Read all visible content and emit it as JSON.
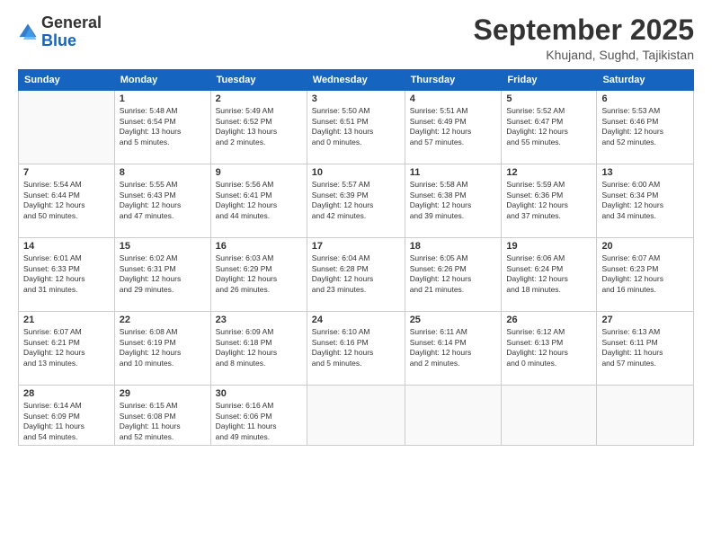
{
  "header": {
    "logo_general": "General",
    "logo_blue": "Blue",
    "month_title": "September 2025",
    "subtitle": "Khujand, Sughd, Tajikistan"
  },
  "days_of_week": [
    "Sunday",
    "Monday",
    "Tuesday",
    "Wednesday",
    "Thursday",
    "Friday",
    "Saturday"
  ],
  "weeks": [
    [
      {
        "day": "",
        "info": ""
      },
      {
        "day": "1",
        "info": "Sunrise: 5:48 AM\nSunset: 6:54 PM\nDaylight: 13 hours\nand 5 minutes."
      },
      {
        "day": "2",
        "info": "Sunrise: 5:49 AM\nSunset: 6:52 PM\nDaylight: 13 hours\nand 2 minutes."
      },
      {
        "day": "3",
        "info": "Sunrise: 5:50 AM\nSunset: 6:51 PM\nDaylight: 13 hours\nand 0 minutes."
      },
      {
        "day": "4",
        "info": "Sunrise: 5:51 AM\nSunset: 6:49 PM\nDaylight: 12 hours\nand 57 minutes."
      },
      {
        "day": "5",
        "info": "Sunrise: 5:52 AM\nSunset: 6:47 PM\nDaylight: 12 hours\nand 55 minutes."
      },
      {
        "day": "6",
        "info": "Sunrise: 5:53 AM\nSunset: 6:46 PM\nDaylight: 12 hours\nand 52 minutes."
      }
    ],
    [
      {
        "day": "7",
        "info": "Sunrise: 5:54 AM\nSunset: 6:44 PM\nDaylight: 12 hours\nand 50 minutes."
      },
      {
        "day": "8",
        "info": "Sunrise: 5:55 AM\nSunset: 6:43 PM\nDaylight: 12 hours\nand 47 minutes."
      },
      {
        "day": "9",
        "info": "Sunrise: 5:56 AM\nSunset: 6:41 PM\nDaylight: 12 hours\nand 44 minutes."
      },
      {
        "day": "10",
        "info": "Sunrise: 5:57 AM\nSunset: 6:39 PM\nDaylight: 12 hours\nand 42 minutes."
      },
      {
        "day": "11",
        "info": "Sunrise: 5:58 AM\nSunset: 6:38 PM\nDaylight: 12 hours\nand 39 minutes."
      },
      {
        "day": "12",
        "info": "Sunrise: 5:59 AM\nSunset: 6:36 PM\nDaylight: 12 hours\nand 37 minutes."
      },
      {
        "day": "13",
        "info": "Sunrise: 6:00 AM\nSunset: 6:34 PM\nDaylight: 12 hours\nand 34 minutes."
      }
    ],
    [
      {
        "day": "14",
        "info": "Sunrise: 6:01 AM\nSunset: 6:33 PM\nDaylight: 12 hours\nand 31 minutes."
      },
      {
        "day": "15",
        "info": "Sunrise: 6:02 AM\nSunset: 6:31 PM\nDaylight: 12 hours\nand 29 minutes."
      },
      {
        "day": "16",
        "info": "Sunrise: 6:03 AM\nSunset: 6:29 PM\nDaylight: 12 hours\nand 26 minutes."
      },
      {
        "day": "17",
        "info": "Sunrise: 6:04 AM\nSunset: 6:28 PM\nDaylight: 12 hours\nand 23 minutes."
      },
      {
        "day": "18",
        "info": "Sunrise: 6:05 AM\nSunset: 6:26 PM\nDaylight: 12 hours\nand 21 minutes."
      },
      {
        "day": "19",
        "info": "Sunrise: 6:06 AM\nSunset: 6:24 PM\nDaylight: 12 hours\nand 18 minutes."
      },
      {
        "day": "20",
        "info": "Sunrise: 6:07 AM\nSunset: 6:23 PM\nDaylight: 12 hours\nand 16 minutes."
      }
    ],
    [
      {
        "day": "21",
        "info": "Sunrise: 6:07 AM\nSunset: 6:21 PM\nDaylight: 12 hours\nand 13 minutes."
      },
      {
        "day": "22",
        "info": "Sunrise: 6:08 AM\nSunset: 6:19 PM\nDaylight: 12 hours\nand 10 minutes."
      },
      {
        "day": "23",
        "info": "Sunrise: 6:09 AM\nSunset: 6:18 PM\nDaylight: 12 hours\nand 8 minutes."
      },
      {
        "day": "24",
        "info": "Sunrise: 6:10 AM\nSunset: 6:16 PM\nDaylight: 12 hours\nand 5 minutes."
      },
      {
        "day": "25",
        "info": "Sunrise: 6:11 AM\nSunset: 6:14 PM\nDaylight: 12 hours\nand 2 minutes."
      },
      {
        "day": "26",
        "info": "Sunrise: 6:12 AM\nSunset: 6:13 PM\nDaylight: 12 hours\nand 0 minutes."
      },
      {
        "day": "27",
        "info": "Sunrise: 6:13 AM\nSunset: 6:11 PM\nDaylight: 11 hours\nand 57 minutes."
      }
    ],
    [
      {
        "day": "28",
        "info": "Sunrise: 6:14 AM\nSunset: 6:09 PM\nDaylight: 11 hours\nand 54 minutes."
      },
      {
        "day": "29",
        "info": "Sunrise: 6:15 AM\nSunset: 6:08 PM\nDaylight: 11 hours\nand 52 minutes."
      },
      {
        "day": "30",
        "info": "Sunrise: 6:16 AM\nSunset: 6:06 PM\nDaylight: 11 hours\nand 49 minutes."
      },
      {
        "day": "",
        "info": ""
      },
      {
        "day": "",
        "info": ""
      },
      {
        "day": "",
        "info": ""
      },
      {
        "day": "",
        "info": ""
      }
    ]
  ]
}
